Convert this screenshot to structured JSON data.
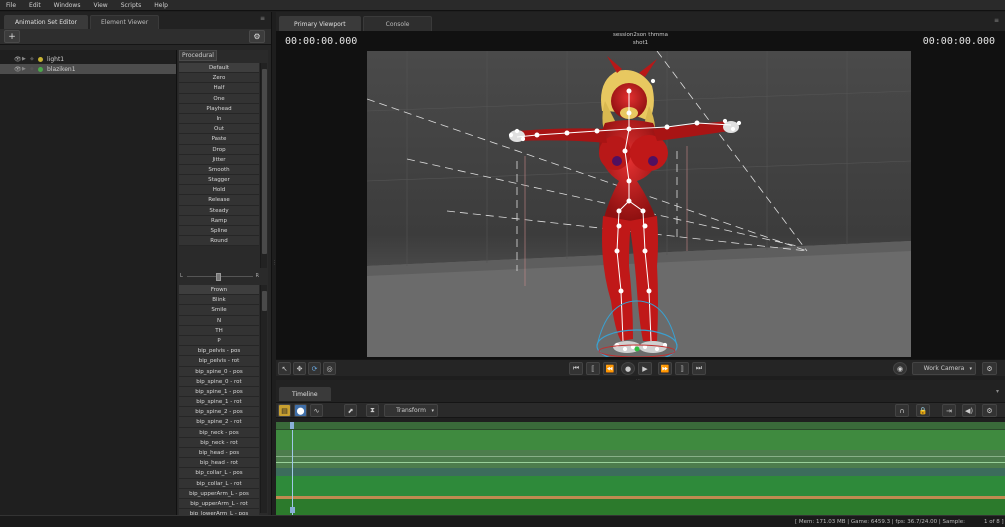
{
  "menu": [
    "File",
    "Edit",
    "Windows",
    "View",
    "Scripts",
    "Help"
  ],
  "left_tabs": [
    {
      "label": "Animation Set Editor",
      "active": true
    },
    {
      "label": "Element Viewer",
      "active": false
    }
  ],
  "tree_items": [
    {
      "label": "light1",
      "color": "#c8b432",
      "selected": false
    },
    {
      "label": "blaziken1",
      "color": "#4aa84a",
      "selected": true
    }
  ],
  "procedural_tab": "Procedural",
  "procedural_items": [
    "Default",
    "Zero",
    "Half",
    "One",
    "Playhead",
    "In",
    "Out",
    "Paste",
    "Drop",
    "Jitter",
    "Smooth",
    "Stagger",
    "Hold",
    "Release",
    "Steady",
    "Ramp",
    "Spline",
    "Round"
  ],
  "slider_labels": {
    "left": "L",
    "right": "R"
  },
  "control_items": [
    "Frown",
    "Blink",
    "Smile",
    "N",
    "TH",
    "P",
    "bip_pelvis - pos",
    "bip_pelvis - rot",
    "bip_spine_0 - pos",
    "bip_spine_0 - rot",
    "bip_spine_1 - pos",
    "bip_spine_1 - rot",
    "bip_spine_2 - pos",
    "bip_spine_2 - rot",
    "bip_neck - pos",
    "bip_neck - rot",
    "bip_head - pos",
    "bip_head - rot",
    "bip_collar_L - pos",
    "bip_collar_L - rot",
    "bip_upperArm_L - pos",
    "bip_upperArm_L - rot",
    "bip_lowerArm_L - pos"
  ],
  "viewport": {
    "tabs": [
      {
        "label": "Primary Viewport",
        "active": true
      },
      {
        "label": "Console",
        "active": false
      }
    ],
    "timecode_left": "00:00:00.000",
    "timecode_right": "00:00:00.000",
    "session": "session2son thmma",
    "shot": "shot1",
    "camera": "Work Camera",
    "playback": [
      "⏮",
      "⟦",
      "⏪",
      "●",
      "▶",
      "⏩",
      "⟧",
      "⏭"
    ]
  },
  "timeline": {
    "tab": "Timeline",
    "dropdown": "Transform"
  },
  "status": {
    "mem": "[ Mem: 171.03 MB | Game: 6459.3 | fps: 36.7/24.00 | Sample:",
    "page": "1 of 8 ]"
  },
  "colors": {
    "accent_blue": "#4a7fb0",
    "track_green": "#2e7a2e",
    "model_red": "#c81e1e"
  }
}
